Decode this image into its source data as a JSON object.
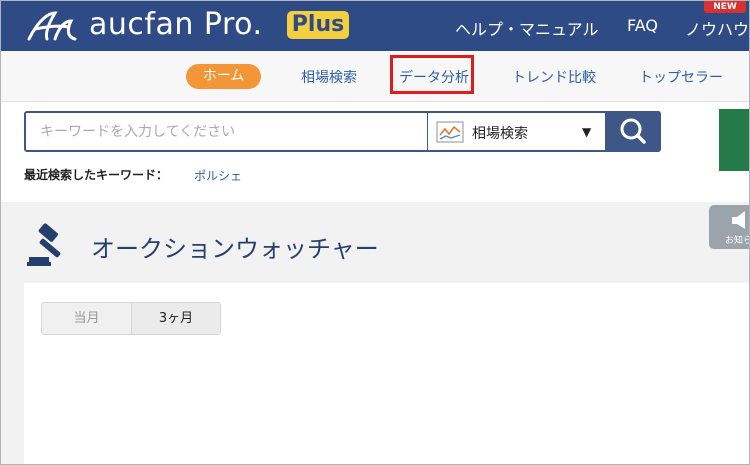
{
  "header": {
    "logo_text": "aucfan Pro.",
    "plan_badge": "Plus",
    "nav": [
      "ヘルプ・マニュアル",
      "FAQ",
      "ノウハウ"
    ],
    "new_badge": "NEW"
  },
  "subnav": {
    "items": [
      "ホーム",
      "相場検索",
      "データ分析",
      "トレンド比較",
      "トップセラー"
    ],
    "active_index": 0,
    "highlighted_index": 2
  },
  "search": {
    "placeholder": "キーワードを入力してください",
    "category": "相場検索",
    "recent_label": "最近検索したキーワード：",
    "recent_keyword": "ポルシェ"
  },
  "side_tab": {
    "label": "お知ら"
  },
  "page": {
    "title": "オークションウォッチャー"
  },
  "tabs": {
    "items": [
      "当月",
      "3ヶ月"
    ],
    "selected_index": 1
  },
  "colors": {
    "header_bg": "#2f4b86",
    "badge_yellow": "#f4cf3f",
    "home_orange": "#f29638",
    "link_blue": "#2f5fa8",
    "highlight_red": "#e01d1d",
    "title_navy": "#26406e"
  },
  "icons": [
    "aucfan-logo-icon",
    "chart-icon",
    "search-icon",
    "gavel-icon",
    "speaker-icon"
  ]
}
